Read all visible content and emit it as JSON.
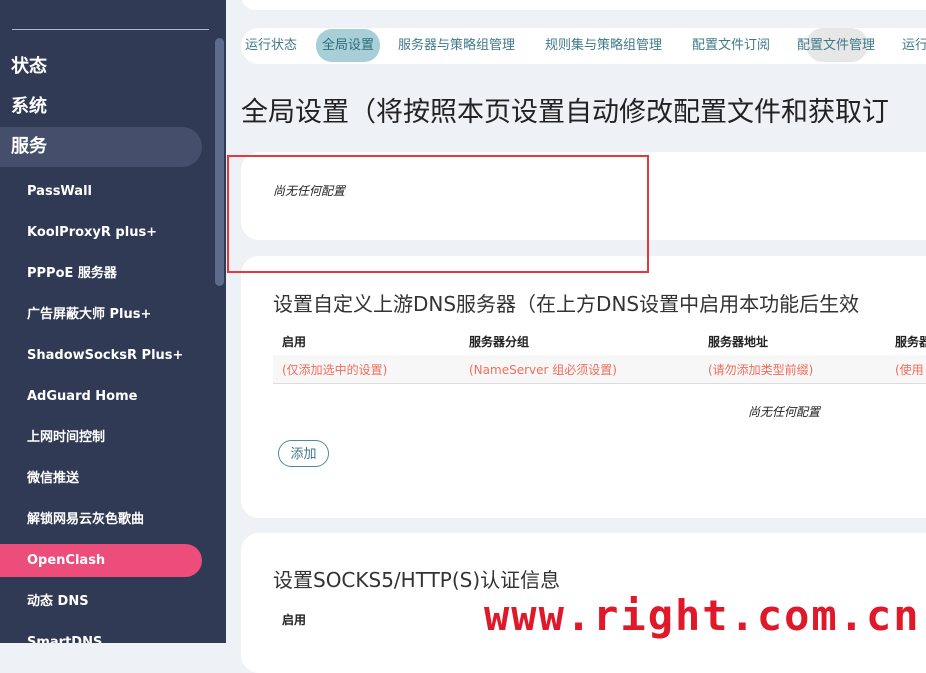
{
  "sidebar": {
    "top_items": [
      {
        "label": "状态"
      },
      {
        "label": "系统"
      },
      {
        "label": "服务"
      }
    ],
    "sub_items": [
      {
        "label": "PassWall"
      },
      {
        "label": "KoolProxyR plus+"
      },
      {
        "label": "PPPoE 服务器"
      },
      {
        "label": "广告屏蔽大师 Plus+"
      },
      {
        "label": "ShadowSocksR Plus+"
      },
      {
        "label": "AdGuard Home"
      },
      {
        "label": "上网时间控制"
      },
      {
        "label": "微信推送"
      },
      {
        "label": "解锁网易云灰色歌曲"
      },
      {
        "label": "OpenClash"
      },
      {
        "label": "动态 DNS"
      },
      {
        "label": "SmartDNS"
      }
    ],
    "active_sub": "OpenClash"
  },
  "tabs": [
    {
      "label": "运行状态"
    },
    {
      "label": "全局设置"
    },
    {
      "label": "服务器与策略组管理"
    },
    {
      "label": "规则集与策略组管理"
    },
    {
      "label": "配置文件订阅"
    },
    {
      "label": "配置文件管理"
    },
    {
      "label": "运行"
    }
  ],
  "page_title": "全局设置（将按照本页设置自动修改配置文件和获取订",
  "section1": {
    "empty_text": "尚无任何配置"
  },
  "dns_section": {
    "title": "设置自定义上游DNS服务器（在上方DNS设置中启用本功能后生效",
    "columns": [
      "启用",
      "服务器分组",
      "服务器地址",
      "服务器"
    ],
    "hints": [
      "(仅添加选中的设置)",
      "(NameServer 组必须设置)",
      "(请勿添加类型前缀)",
      "(使用"
    ],
    "empty_text": "尚无任何配置",
    "add_label": "添加"
  },
  "auth_section": {
    "title": "设置SOCKS5/HTTP(S)认证信息",
    "columns": [
      "启用"
    ]
  },
  "watermark": "www.right.com.cn",
  "colors": {
    "sidebar_bg": "#313a55",
    "active_item": "#ec4d7a",
    "accent": "#3f7a8a",
    "hint_red": "#f26d5b",
    "highlight": "#e03a3a"
  }
}
